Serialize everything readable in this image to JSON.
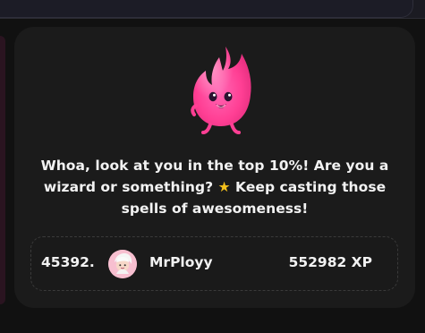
{
  "card": {
    "message_prefix": "Whoa, look at you in the top 10%! Are you a wizard or something?",
    "message_emoji": "★",
    "message_suffix": "Keep casting those spells of awesomeness!"
  },
  "leaderboard_row": {
    "rank": "45392.",
    "username": "MrPloyy",
    "xp": "552982 XP"
  },
  "icons": {
    "mascot": "pink-fire-mascot-icon",
    "avatar": "user-avatar",
    "emoji": "star-icon"
  },
  "colors": {
    "background": "#111111",
    "card": "#1b1b1b",
    "text": "#f2f2f2",
    "mascot_pink": "#ff3f94",
    "avatar_pink": "#f6b6c8",
    "star_gold": "#f6c21c"
  }
}
